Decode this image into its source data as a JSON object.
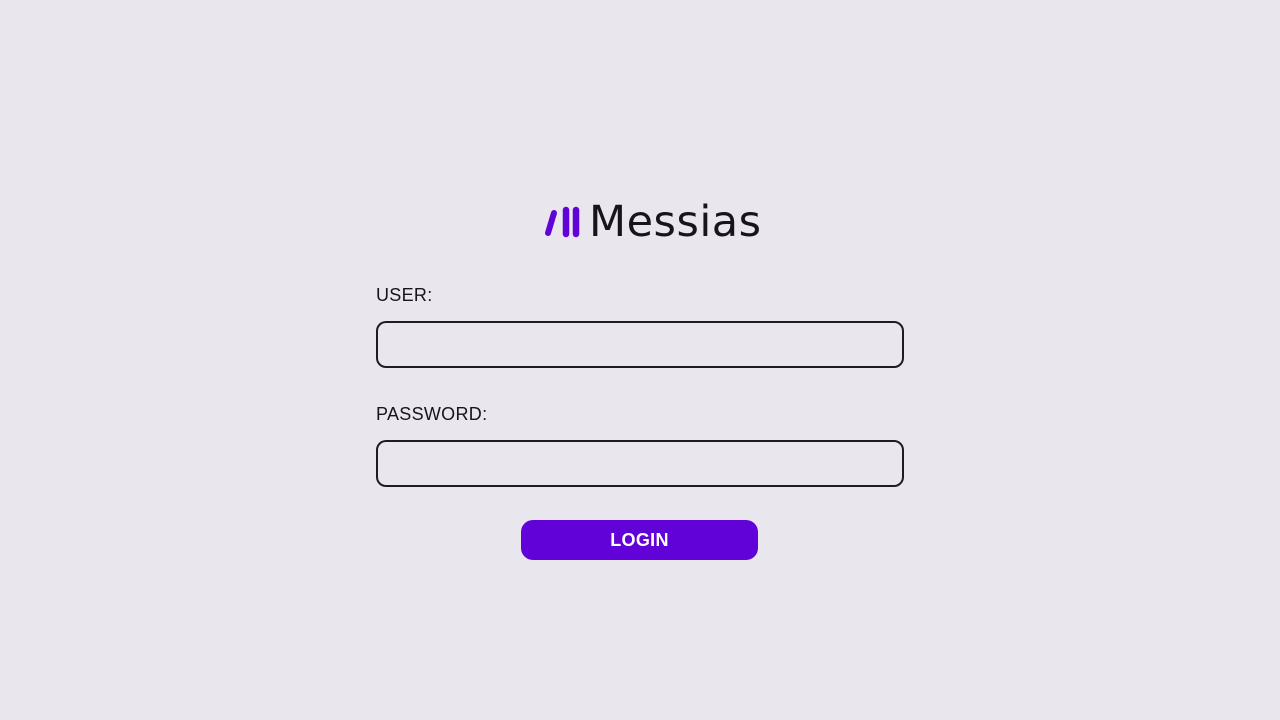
{
  "brand": {
    "name": "Messias",
    "logo_icon": "messias-logo-icon",
    "accent_color": "#6002d8"
  },
  "form": {
    "user_label": "USER:",
    "user_value": "",
    "password_label": "PASSWORD:",
    "password_value": ""
  },
  "login_button": {
    "label": "LOGIN",
    "color": "#6002d8"
  }
}
